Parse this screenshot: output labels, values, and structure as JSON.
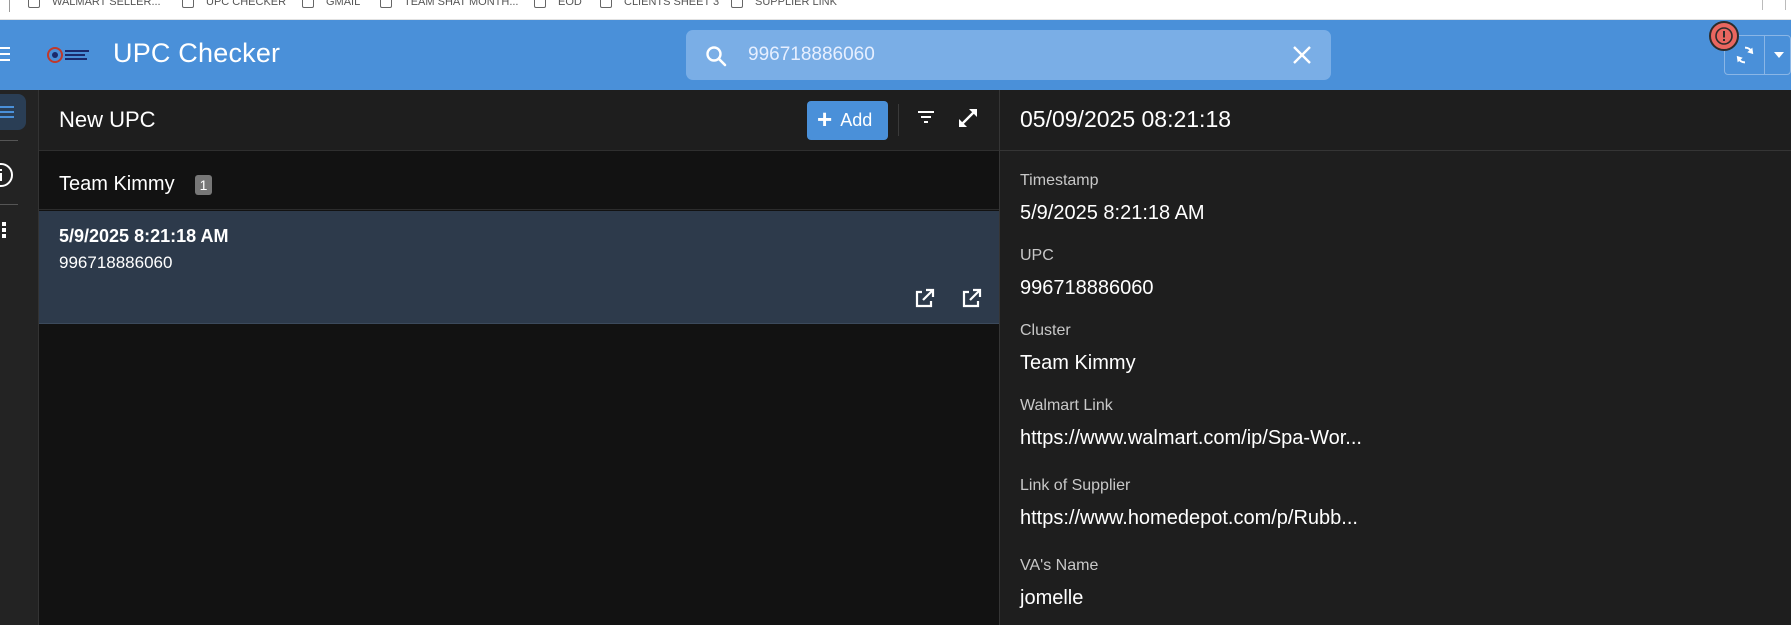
{
  "bookmarks": [
    {
      "label": "WALMART SELLER..."
    },
    {
      "label": "UPC CHECKER"
    },
    {
      "label": "GMAIL"
    },
    {
      "label": "TEAM SHAT MONTH..."
    },
    {
      "label": "EOD"
    },
    {
      "label": "CLIENTS SHEET 3"
    },
    {
      "label": "SUPPLIER LINK"
    }
  ],
  "header": {
    "title": "UPC Checker",
    "logo_icon": "company-logo-icon"
  },
  "search": {
    "value": "996718886060",
    "placeholder": "Search"
  },
  "list_panel": {
    "title": "New UPC",
    "add_label": "Add",
    "group": {
      "name": "Team Kimmy",
      "count": "1"
    },
    "rows": [
      {
        "timestamp": "5/9/2025 8:21:18 AM",
        "upc": "996718886060"
      }
    ]
  },
  "detail": {
    "title": "05/09/2025 08:21:18",
    "fields": [
      {
        "label": "Timestamp",
        "value": "5/9/2025 8:21:18 AM"
      },
      {
        "label": "UPC",
        "value": "996718886060"
      },
      {
        "label": "Cluster",
        "value": "Team Kimmy"
      },
      {
        "label": "Walmart Link",
        "value": "https://www.walmart.com/ip/Spa-Wor..."
      },
      {
        "label": "Link of Supplier",
        "value": "https://www.homedepot.com/p/Rubb..."
      },
      {
        "label": "VA's Name",
        "value": "jomelle"
      }
    ]
  },
  "colors": {
    "header": "#4a90d9",
    "search_bg": "#7aaee6",
    "selected_row": "#2d3a4b",
    "panel_bg": "#121212",
    "error_badge": "#e9665f"
  }
}
